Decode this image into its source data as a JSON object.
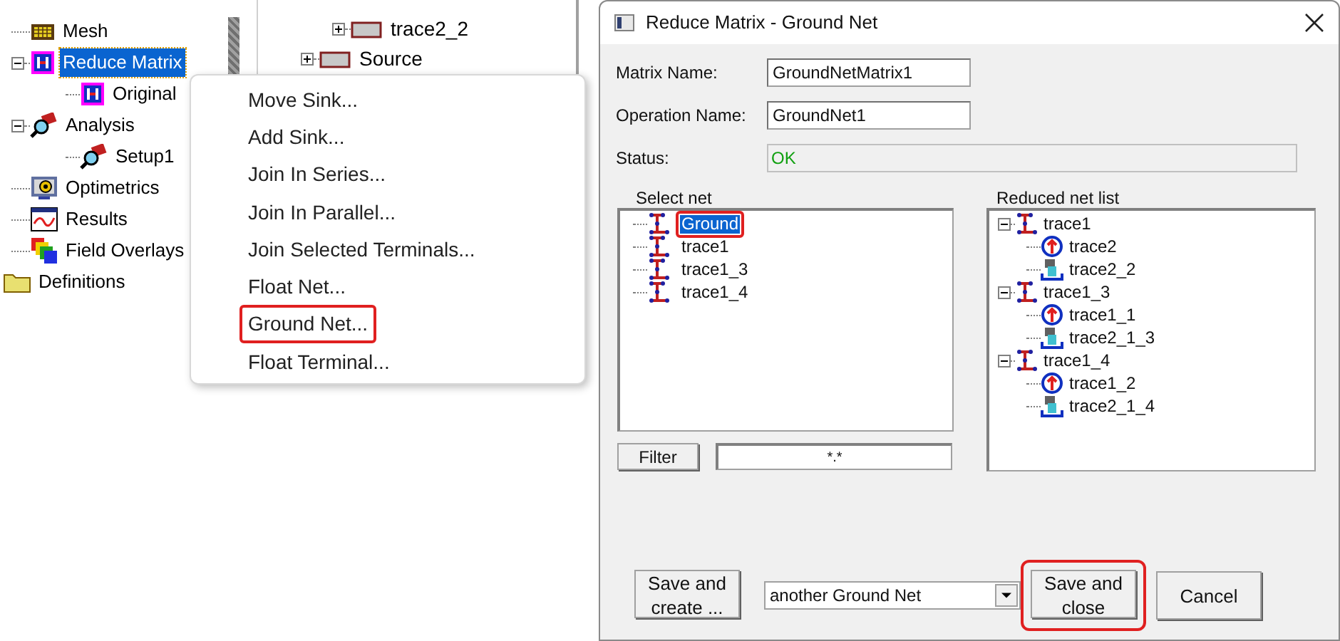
{
  "project_tree": {
    "items": [
      {
        "label": "Mesh",
        "kind": "mesh",
        "selected": false
      },
      {
        "label": "Reduce Matrix",
        "kind": "matrix",
        "selected": true,
        "expanded": true,
        "children": [
          {
            "label": "Original",
            "kind": "matrix",
            "selected": false
          }
        ]
      },
      {
        "label": "Analysis",
        "kind": "analysis",
        "selected": false,
        "expanded": true,
        "children": [
          {
            "label": "Setup1",
            "kind": "analysis",
            "selected": false
          }
        ]
      },
      {
        "label": "Optimetrics",
        "kind": "optimetrics",
        "selected": false
      },
      {
        "label": "Results",
        "kind": "results",
        "selected": false
      },
      {
        "label": "Field Overlays",
        "kind": "overlays",
        "selected": false
      },
      {
        "label": "Definitions",
        "kind": "folder",
        "selected": false
      }
    ]
  },
  "net_tree": {
    "items": [
      {
        "label": "trace2_2",
        "expanded": false,
        "nested": true
      },
      {
        "label": "Source",
        "expanded": false,
        "nested": false
      }
    ]
  },
  "context_menu": {
    "items": [
      {
        "label": "Move Sink...",
        "highlighted": false
      },
      {
        "label": "Add Sink...",
        "highlighted": false
      },
      {
        "label": "Join In Series...",
        "highlighted": false
      },
      {
        "label": "Join In Parallel...",
        "highlighted": false
      },
      {
        "label": "Join Selected Terminals...",
        "highlighted": false
      },
      {
        "label": "Float Net...",
        "highlighted": false
      },
      {
        "label": "Ground Net...",
        "highlighted": true
      },
      {
        "label": "Float Terminal...",
        "highlighted": false
      }
    ]
  },
  "dialog": {
    "title": "Reduce Matrix - Ground Net",
    "fields": [
      {
        "label": "Matrix Name:",
        "value": "GroundNetMatrix1"
      },
      {
        "label": "Operation Name:",
        "value": "GroundNet1"
      }
    ],
    "status": {
      "label": "Status:",
      "value": "OK"
    },
    "select_net": {
      "title": "Select net",
      "items": [
        {
          "label": "Ground",
          "selected": true,
          "highlighted": true
        },
        {
          "label": "trace1",
          "selected": false,
          "highlighted": false
        },
        {
          "label": "trace1_3",
          "selected": false,
          "highlighted": false
        },
        {
          "label": "trace1_4",
          "selected": false,
          "highlighted": false
        }
      ]
    },
    "filter": {
      "button": "Filter",
      "value": "*.*"
    },
    "reduced_net_list": {
      "title": "Reduced net list",
      "items": [
        {
          "label": "trace1",
          "expanded": true,
          "children": [
            {
              "label": "trace2",
              "kind": "source"
            },
            {
              "label": "trace2_2",
              "kind": "sink"
            }
          ]
        },
        {
          "label": "trace1_3",
          "expanded": true,
          "children": [
            {
              "label": "trace1_1",
              "kind": "source"
            },
            {
              "label": "trace2_1_3",
              "kind": "sink"
            }
          ]
        },
        {
          "label": "trace1_4",
          "expanded": true,
          "children": [
            {
              "label": "trace1_2",
              "kind": "source"
            },
            {
              "label": "trace2_1_4",
              "kind": "sink"
            }
          ]
        }
      ]
    },
    "save_create_button": {
      "label": "Save and create ...",
      "highlighted": false
    },
    "next_operation": {
      "value": "another Ground Net"
    },
    "save_close_button": {
      "label": "Save and close",
      "highlighted": true
    },
    "cancel_button": {
      "label": "Cancel",
      "highlighted": false
    }
  }
}
